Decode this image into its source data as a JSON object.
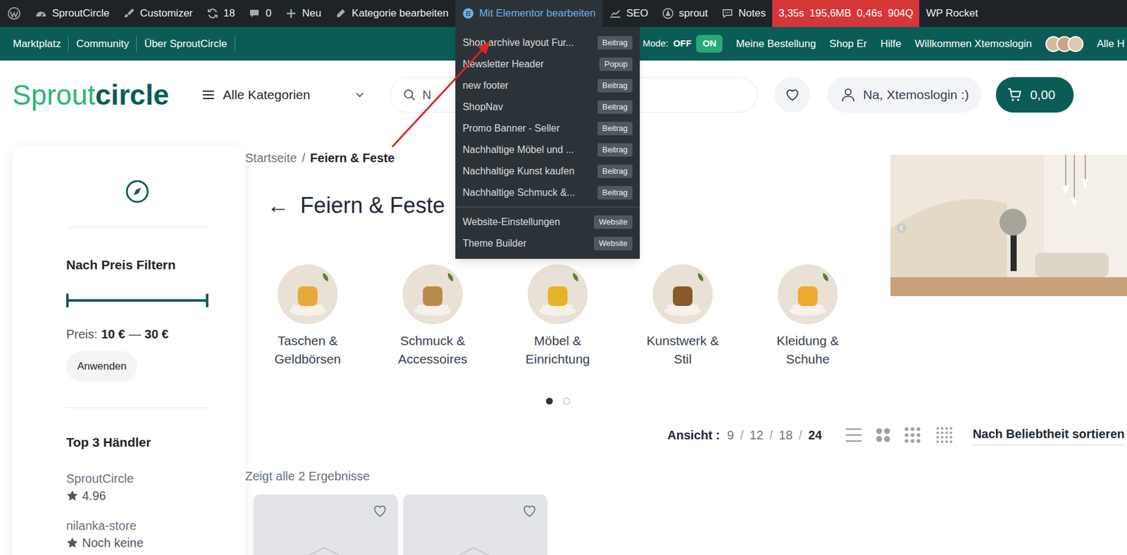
{
  "admin_bar": {
    "items": [
      {
        "label": "SproutCircle",
        "expanded": false
      },
      {
        "label": "Customizer",
        "expanded": false
      },
      {
        "label": "18",
        "expanded": false
      },
      {
        "label": "0",
        "expanded": false
      },
      {
        "label": "Neu",
        "expanded": false
      },
      {
        "label": "Kategorie bearbeiten",
        "expanded": false
      },
      {
        "label": "Mit Elementor bearbeiten",
        "expanded": true
      },
      {
        "label": "SEO",
        "expanded": false
      },
      {
        "label": "sprout",
        "expanded": false
      },
      {
        "label": "Notes",
        "expanded": false
      }
    ],
    "query_monitor": [
      "3,35s",
      "195,6MB",
      "0,46s",
      "904Q"
    ],
    "rocket": "WP Rocket"
  },
  "elementor_menu": {
    "groups": [
      [
        {
          "label": "Shop archive layout Fur...",
          "badge": "Beitrag"
        },
        {
          "label": "Newsletter Header",
          "badge": "Popup"
        },
        {
          "label": "new footer",
          "badge": "Beitrag"
        },
        {
          "label": "ShopNav",
          "badge": "Beitrag"
        },
        {
          "label": "Promo Banner - Seller",
          "badge": "Beitrag"
        },
        {
          "label": "Nachhaltige Möbel und ...",
          "badge": "Beitrag"
        },
        {
          "label": "Nachhaltige Kunst kaufen",
          "badge": "Beitrag"
        },
        {
          "label": "Nachhaltige Schmuck &...",
          "badge": "Beitrag"
        }
      ],
      [
        {
          "label": "Website-Einstellungen",
          "badge": "Website"
        },
        {
          "label": "Theme Builder",
          "badge": "Website"
        }
      ]
    ]
  },
  "top_nav": {
    "links": [
      "Marktplatz",
      "Community",
      "Über SproutCircle"
    ],
    "coming_soon": {
      "label": "Coming Soon Mode:",
      "off": "OFF",
      "on": "ON",
      "enabled": true
    },
    "right_links": [
      "Meine Bestellung",
      "Shop Er",
      "Hilfe"
    ],
    "welcome": "Willkommen Xtemoslogin",
    "cut": "Alle H"
  },
  "header": {
    "logo": [
      "Sprout",
      "circle"
    ],
    "categories": "Alle Kategorien",
    "search": {
      "placeholder": "N"
    },
    "account": "Na, Xtemoslogin :)",
    "cart": "0,00"
  },
  "breadcrumb": {
    "items": [
      {
        "label": "Startseite",
        "current": false
      },
      {
        "label": "Feiern & Feste",
        "current": true
      }
    ],
    "separator": "/"
  },
  "title": {
    "back": "←",
    "text": "Feiern & Feste"
  },
  "categories": [
    {
      "lines": [
        "Taschen &",
        "Geldbörsen"
      ]
    },
    {
      "lines": [
        "Schmuck &",
        "Accessoires"
      ]
    },
    {
      "lines": [
        "Möbel &",
        "Einrichtung"
      ]
    },
    {
      "lines": [
        "Kunstwerk &",
        "Stil"
      ]
    },
    {
      "lines": [
        "Kleidung &",
        "Schuhe"
      ]
    }
  ],
  "carousel_dots": [
    {
      "selected": true
    },
    {
      "selected": false
    }
  ],
  "sidebar": {
    "price_filter": {
      "title": "Nach Preis Filtern",
      "low": 0,
      "high": 1,
      "label": "Preis:",
      "min": "10 €",
      "dash": "—",
      "max": "30 €",
      "button": "Anwenden"
    },
    "vendors": {
      "title": "Top 3 Händler",
      "items": [
        {
          "name": "SproutCircle",
          "rating": "4.96"
        },
        {
          "name": "nilanka-store",
          "rating": "Noch keine"
        }
      ]
    }
  },
  "toolbar": {
    "label": "Ansicht :",
    "separator": "/",
    "per_page": [
      {
        "label": "9",
        "selected": false
      },
      {
        "label": "12",
        "selected": false
      },
      {
        "label": "18",
        "selected": false
      },
      {
        "label": "24",
        "selected": true
      }
    ],
    "sort": "Nach Beliebtheit sortieren"
  },
  "results": "Zeigt alle 2 Ergebnisse",
  "products": [
    {
      "wishlisted": false
    },
    {
      "wishlisted": false
    }
  ]
}
